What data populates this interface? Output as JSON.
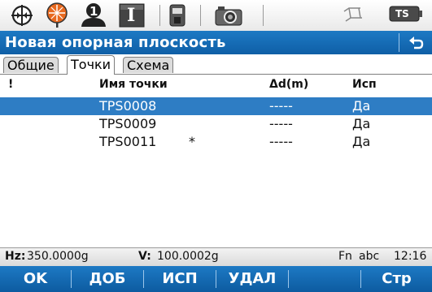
{
  "toolbar": {
    "icons": [
      "crosshair-icon",
      "prism-target-icon",
      "user-info-icon",
      "instrument-i-icon",
      "battery-icon",
      "camera-icon",
      "level-icon",
      "ts-mode-icon"
    ],
    "info_digit": "1",
    "instrument_letter": "I",
    "ts_badge": "TS"
  },
  "header": {
    "title": "Новая опорная плоскость"
  },
  "tabs": [
    {
      "label": "Общие",
      "active": false
    },
    {
      "label": "Точки",
      "active": true
    },
    {
      "label": "Схема",
      "active": false
    }
  ],
  "table": {
    "columns": [
      "!",
      "Имя точки",
      "Δd(m)",
      "Исп"
    ],
    "rows": [
      {
        "flag": "",
        "name": "TPS0008",
        "mark": "",
        "dd": "-----",
        "use": "Да",
        "selected": true
      },
      {
        "flag": "",
        "name": "TPS0009",
        "mark": "",
        "dd": "-----",
        "use": "Да",
        "selected": false
      },
      {
        "flag": "",
        "name": "TPS0011",
        "mark": "*",
        "dd": "-----",
        "use": "Да",
        "selected": false
      }
    ]
  },
  "status": {
    "hz_label": "Hz:",
    "hz_value": "350.0000g",
    "v_label": "V:",
    "v_value": "100.0002g",
    "fn": "Fn",
    "input_mode": "abc",
    "time": "12:16"
  },
  "fkeys": [
    "OK",
    "ДОБ",
    "ИСП",
    "УДАЛ",
    "",
    "Стр"
  ],
  "colors": {
    "accent": "#1d79c4",
    "selection": "#2e7dc4",
    "target_orange": "#e8691f"
  }
}
